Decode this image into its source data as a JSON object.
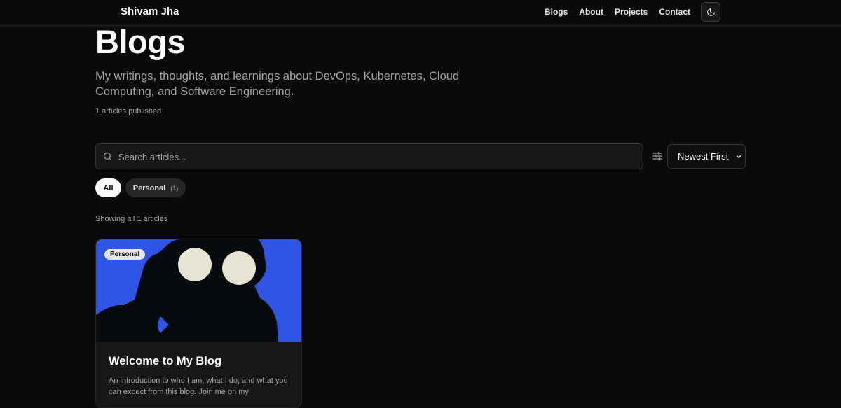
{
  "header": {
    "brand": "Shivam Jha",
    "nav": [
      {
        "label": "Blogs"
      },
      {
        "label": "About"
      },
      {
        "label": "Projects"
      },
      {
        "label": "Contact"
      }
    ],
    "theme_toggle_icon": "moon-icon"
  },
  "page": {
    "title": "Blogs",
    "subtitle": "My writings, thoughts, and learnings about DevOps, Kubernetes, Cloud Computing, and Software Engineering.",
    "published_count": "1 articles published"
  },
  "search": {
    "placeholder": "Search articles...",
    "value": "",
    "icon": "search-icon"
  },
  "filter_icon": "sliders-icon",
  "sort": {
    "selected": "Newest First"
  },
  "categories": [
    {
      "label": "All",
      "active": true
    },
    {
      "label": "Personal",
      "count": "(1)",
      "active": false
    }
  ],
  "results_text": "Showing all 1 articles",
  "articles": [
    {
      "badge": "Personal",
      "title": "Welcome to My Blog",
      "excerpt": "An introduction to who I am, what I do, and what you can expect from this blog. Join me on my"
    }
  ],
  "colors": {
    "background": "#0a0a0a",
    "card": "#171717",
    "cover_blue": "#2f55e4",
    "cover_dark": "#070b0e",
    "cover_circle": "#e8e4d4"
  }
}
